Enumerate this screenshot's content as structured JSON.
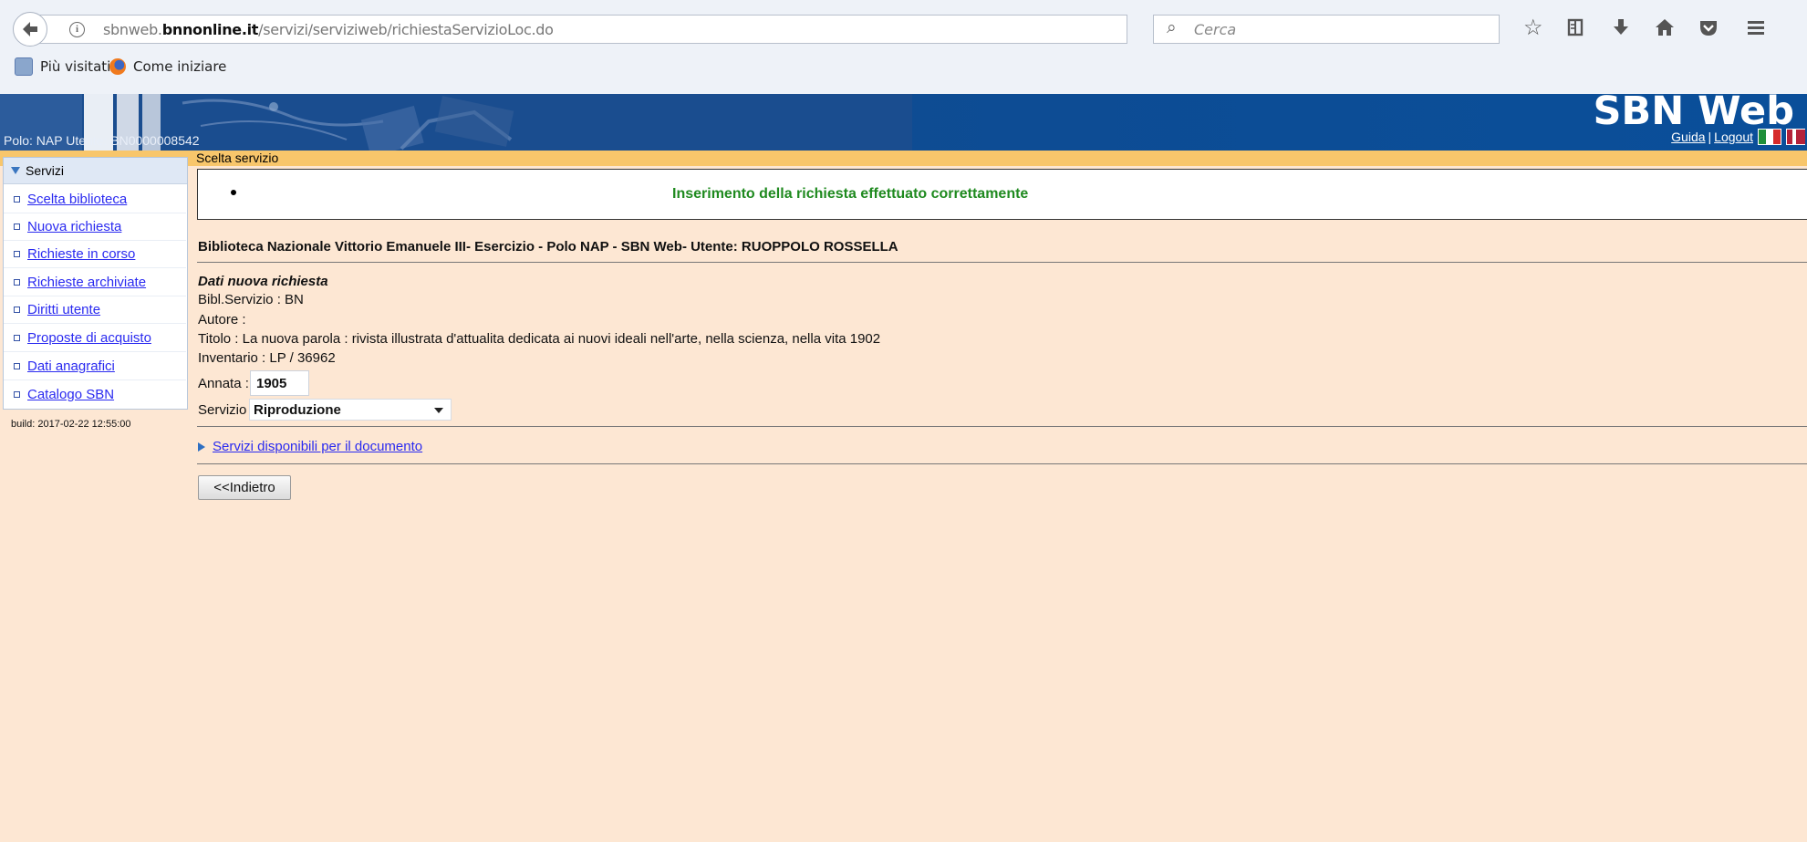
{
  "browser": {
    "url_prefix": "sbnweb.",
    "url_domain": "bnnonline.it",
    "url_path": "/servizi/serviziweb/richiestaServizioLoc.do",
    "search_placeholder": "Cerca",
    "bookmarks": [
      "Più visitati",
      "Come iniziare"
    ]
  },
  "header": {
    "app_title": "SBN Web",
    "user_line": "Polo: NAP  Utente: BN0000008542",
    "guida": "Guida",
    "separator": "|",
    "logout": "Logout"
  },
  "tabbar": {
    "label": "Scelta servizio"
  },
  "sidebar": {
    "header": "Servizi",
    "items": [
      {
        "label": "Scelta biblioteca"
      },
      {
        "label": "Nuova richiesta"
      },
      {
        "label": "Richieste in corso"
      },
      {
        "label": "Richieste archiviate"
      },
      {
        "label": "Diritti utente"
      },
      {
        "label": "Proposte di acquisto"
      },
      {
        "label": "Dati anagrafici"
      },
      {
        "label": "Catalogo SBN"
      }
    ],
    "build": "build: 2017-02-22 12:55:00"
  },
  "main": {
    "message": "Inserimento della richiesta effettuato correttamente",
    "library_line": "Biblioteca Nazionale Vittorio Emanuele III- Esercizio - Polo NAP - SBN Web- Utente: RUOPPOLO ROSSELLA",
    "dati_title": "Dati nuova richiesta",
    "bibl_servizio": "Bibl.Servizio : BN",
    "autore": "Autore :",
    "titolo": "Titolo : La nuova parola : rivista illustrata d'attualita dedicata ai nuovi ideali nell'arte, nella scienza, nella vita 1902",
    "inventario": "Inventario : LP / 36962",
    "annata_label": "Annata :",
    "annata_value": "1905",
    "servizio_label": "Servizio",
    "servizio_value": "Riproduzione",
    "servizi_disponibili": "Servizi disponibili per il documento",
    "back_button": "<<Indietro"
  },
  "icons": {
    "back": "back-arrow-icon",
    "info": "info-icon",
    "reload": "reload-icon",
    "search": "search-icon",
    "star": "star-icon",
    "reading_list": "reading-list-icon",
    "download": "download-icon",
    "home": "home-icon",
    "pocket": "pocket-icon",
    "menu": "menu-icon"
  },
  "colors": {
    "banner_blue": "#0f4a90",
    "tab_orange": "#f8c66b",
    "page_bg": "#fde7d3",
    "success_green": "#1f8a1f",
    "link_blue": "#2a2af0"
  }
}
